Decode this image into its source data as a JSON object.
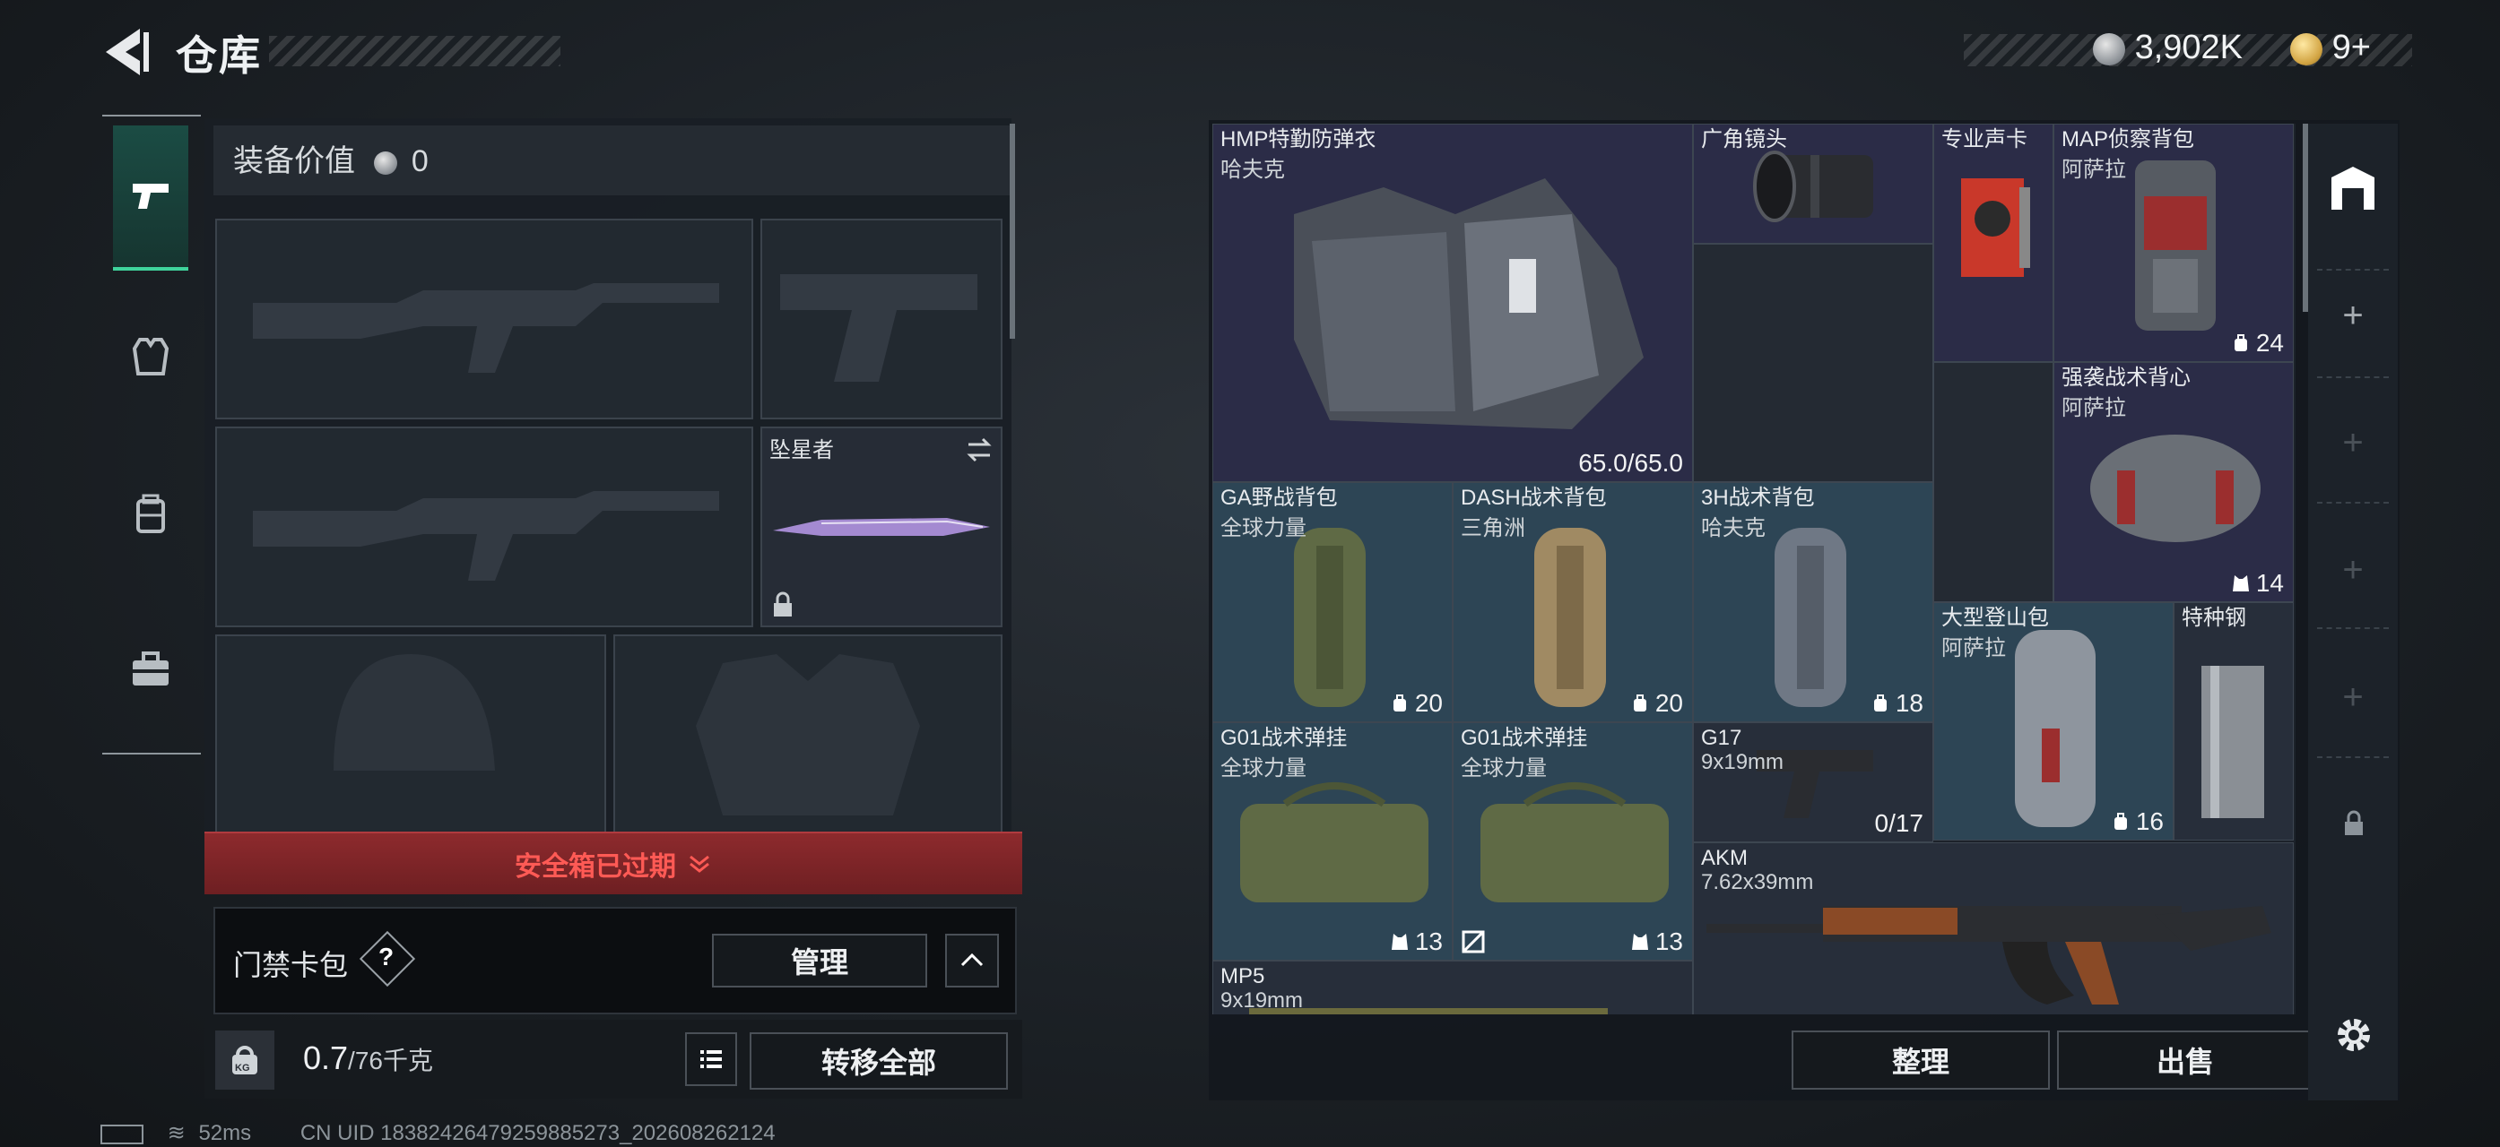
{
  "header": {
    "title": "仓库"
  },
  "currency": {
    "silver": "3,902K",
    "gold": "9+"
  },
  "loadout": {
    "equip_value_label": "装备价值",
    "equip_value": "0",
    "melee_name": "坠星者",
    "safebox_warning": "安全箱已过期",
    "keycard_label": "门禁卡包",
    "keycard_help": "?",
    "manage_label": "管理",
    "weight_value": "0.7",
    "weight_cap": "/76千克",
    "weight_icon_text": "KG",
    "transfer_all_label": "转移全部"
  },
  "stash": {
    "items": [
      {
        "name": "HMP特勤防弹衣",
        "sub": "哈夫克",
        "value": "65.0/65.0"
      },
      {
        "name": "广角镜头",
        "sub": "",
        "value": ""
      },
      {
        "name": "专业声卡",
        "sub": "",
        "value": ""
      },
      {
        "name": "MAP侦察背包",
        "sub": "阿萨拉",
        "value": "24"
      },
      {
        "name": "强袭战术背心",
        "sub": "阿萨拉",
        "value": "14"
      },
      {
        "name": "GA野战背包",
        "sub": "全球力量",
        "value": "20"
      },
      {
        "name": "DASH战术背包",
        "sub": "三角洲",
        "value": "20"
      },
      {
        "name": "3H战术背包",
        "sub": "哈夫克",
        "value": "18"
      },
      {
        "name": "大型登山包",
        "sub": "阿萨拉",
        "value": "16"
      },
      {
        "name": "特种钢",
        "sub": "",
        "value": ""
      },
      {
        "name": "G01战术弹挂",
        "sub": "全球力量",
        "value": "13"
      },
      {
        "name": "G01战术弹挂",
        "sub": "全球力量",
        "value": "13"
      },
      {
        "name": "G17",
        "sub": "9x19mm",
        "value": "0/17"
      },
      {
        "name": "AKM",
        "sub": "7.62x39mm",
        "value": ""
      },
      {
        "name": "MP5",
        "sub": "9x19mm",
        "value": ""
      }
    ],
    "sort_label": "整理",
    "sell_label": "出售"
  },
  "footer": {
    "ping": "52ms",
    "uid": "CN UID 18382426479259885273_202608262124"
  },
  "colors": {
    "accent_green": "#3fd39c",
    "warning_red": "#ff5a55",
    "blue_rarity": "#2d4555",
    "purple_rarity": "#2b2c47"
  }
}
